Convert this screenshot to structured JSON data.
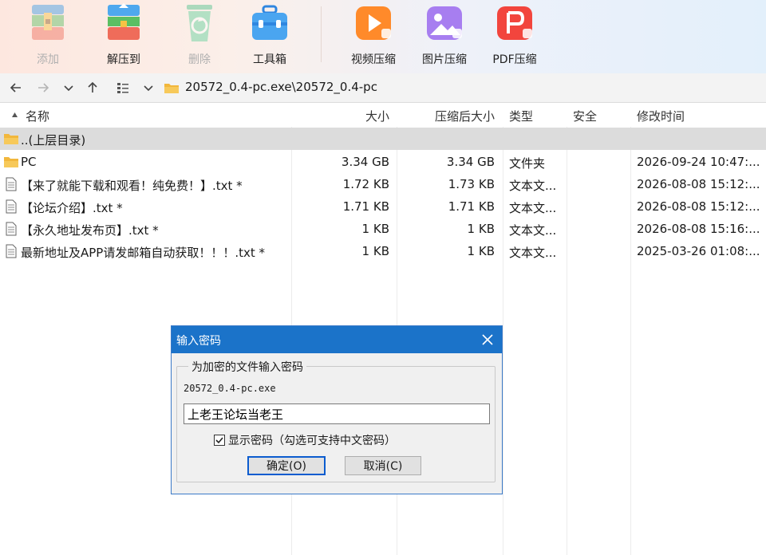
{
  "toolbar": {
    "buttons": [
      {
        "label": "添加",
        "icon": "add-archive-icon",
        "disabled": true
      },
      {
        "label": "解压到",
        "icon": "extract-to-icon",
        "disabled": false
      },
      {
        "label": "删除",
        "icon": "recycle-delete-icon",
        "disabled": true
      },
      {
        "label": "工具箱",
        "icon": "toolbox-icon",
        "disabled": false
      },
      {
        "label": "视频压缩",
        "icon": "video-compress-icon",
        "disabled": false
      },
      {
        "label": "图片压缩",
        "icon": "image-compress-icon",
        "disabled": false
      },
      {
        "label": "PDF压缩",
        "icon": "pdf-compress-icon",
        "disabled": false
      }
    ]
  },
  "addressbar": {
    "path": "20572_0.4-pc.exe\\20572_0.4-pc"
  },
  "columns": {
    "name": "名称",
    "size": "大小",
    "packed": "压缩后大小",
    "type": "类型",
    "security": "安全",
    "modified": "修改时间"
  },
  "rows": [
    {
      "name": "..(上层目录)",
      "size": "",
      "packed": "",
      "type": "",
      "modified": "",
      "icon": "folder-icon"
    },
    {
      "name": "PC",
      "size": "3.34 GB",
      "packed": "3.34 GB",
      "type": "文件夹",
      "modified": "2026-09-24 10:47:...",
      "icon": "folder-icon"
    },
    {
      "name": "【来了就能下载和观看！纯免费！】.txt *",
      "size": "1.72 KB",
      "packed": "1.73 KB",
      "type": "文本文...",
      "modified": "2026-08-08 15:12:...",
      "icon": "text-file-icon"
    },
    {
      "name": "【论坛介绍】.txt *",
      "size": "1.71 KB",
      "packed": "1.71 KB",
      "type": "文本文...",
      "modified": "2026-08-08 15:12:...",
      "icon": "text-file-icon"
    },
    {
      "name": "【永久地址发布页】.txt *",
      "size": "1 KB",
      "packed": "1 KB",
      "type": "文本文...",
      "modified": "2026-08-08 15:16:...",
      "icon": "text-file-icon"
    },
    {
      "name": "最新地址及APP请发邮箱自动获取！！！.txt *",
      "size": "1 KB",
      "packed": "1 KB",
      "type": "文本文...",
      "modified": "2025-03-26 01:08:...",
      "icon": "text-file-icon"
    }
  ],
  "dialog": {
    "title": "输入密码",
    "group_label": "为加密的文件输入密码",
    "file_name": "20572_0.4-pc.exe",
    "password_value": "上老王论坛当老王",
    "show_password_label": "显示密码（勾选可支持中文密码）",
    "show_password_checked": true,
    "ok_label": "确定(O)",
    "cancel_label": "取消(C)"
  },
  "colors": {
    "dialog_title_bar": "#1b73c9",
    "parent_row_bg": "#dcdcdc",
    "folder": "#f2b73c"
  }
}
